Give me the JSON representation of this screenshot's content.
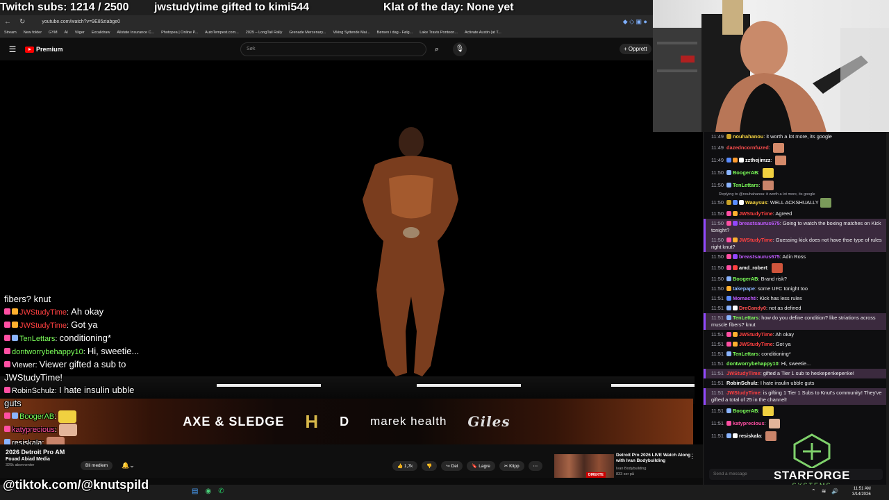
{
  "overlay": {
    "subs_goal": "Twitch subs: 1214 / 2500",
    "gift_alert": "jwstudytime gifted to kimi544",
    "klat": "Klat of the day: None yet",
    "tiktok": "@tiktok.com/@knutspild"
  },
  "browser": {
    "url": "youtube.com/watch?v=9E85ziabge0",
    "bookmarks": [
      "Stream",
      "New folder",
      "GYM",
      "AI",
      "Viiger",
      "Excalidraw",
      "Allstate Insurance C...",
      "Photopea | Online P...",
      "AutoTempest.com...",
      "2025 – LongTail Rally",
      "Grenade Mercenary...",
      "Viking Syttende Mai...",
      "Børsen i dag - Følg...",
      "Lake Travis Pontoon...",
      "Activate Austin (at T..."
    ]
  },
  "youtube": {
    "brand": "Premium",
    "search_placeholder": "Søk",
    "create_label": "Opprett",
    "channel_name": "Fouad Abiad Media",
    "channel_subs": "326k abonnenter",
    "member_label": "Bli medlem",
    "actions": [
      "1,7k",
      "",
      "Del",
      "Lagre",
      "Klipp",
      "⋯"
    ],
    "video_title_overlay": "2026 Detroit Pro AM",
    "sponsors": [
      "AXE & SLEDGE",
      "H",
      "D",
      "marek health",
      "Giles"
    ],
    "rec": {
      "title": "Detroit Pro 2026 LIVE Watch Along with Ivan Bodybuilding",
      "channel": "Ivan Bodybuilding",
      "views": "833 ser på",
      "live_badge": "DIREKTE"
    }
  },
  "chat": {
    "input_placeholder": "Send a message",
    "messages": [
      {
        "ts": "11:49",
        "user": "nouhahanou",
        "color": "#f5d342",
        "text": "it worth a lot more, its google",
        "badges": [
          "#c9a227"
        ],
        "emote": null,
        "hl": false
      },
      {
        "ts": "11:49",
        "user": "dazedncornfuzed",
        "color": "#ff4e4e",
        "text": "",
        "badges": [],
        "emote": "#d58a6a",
        "hl": false
      },
      {
        "ts": "11:49",
        "user": "zzthejimzz",
        "color": "#ffffff",
        "text": "",
        "badges": [
          "#5a8cff",
          "#ff9b2f",
          "#ffffff"
        ],
        "emote": "#d58a6a",
        "hl": false
      },
      {
        "ts": "11:50",
        "user": "BoogerAB",
        "color": "#7cff5a",
        "text": "",
        "badges": [
          "#8ab4ff"
        ],
        "emote": "#f0d040",
        "hl": false
      },
      {
        "ts": "11:50",
        "user": "TenLettars",
        "color": "#7cff5a",
        "text": "",
        "badges": [
          "#8ab4ff"
        ],
        "emote": "#c9846a",
        "hl": false
      },
      {
        "ts": "11:50",
        "user": "Waaysus",
        "color": "#f5d342",
        "text": "WELL ACKSHUALLY",
        "badges": [
          "#c9a227",
          "#5a8cff",
          "#ffffff"
        ],
        "emote": "#7a9a5a",
        "hl": false,
        "reply": "Replying to @nouhahanou: it worth a lot more, its google"
      },
      {
        "ts": "11:50",
        "user": "JWStudyTime",
        "color": "#ff4040",
        "text": "Agreed",
        "badges": [
          "#ff4fa3",
          "#ffb02e"
        ],
        "emote": null,
        "hl": false
      },
      {
        "ts": "11:50",
        "user": "breastsaurus675",
        "color": "#c05bff",
        "text": "Going to watch the boxing matches on Kick tonight?",
        "badges": [
          "#ff4fa3",
          "#9147ff"
        ],
        "emote": null,
        "hl": true
      },
      {
        "ts": "11:50",
        "user": "JWStudyTime",
        "color": "#ff4040",
        "text": "Guessing kick does not have thse type of rules right knut?",
        "badges": [
          "#ff4fa3",
          "#ffb02e"
        ],
        "emote": null,
        "hl": true
      },
      {
        "ts": "11:50",
        "user": "breastsaurus675",
        "color": "#c05bff",
        "text": "Adin Ross",
        "badges": [
          "#ff4fa3",
          "#9147ff"
        ],
        "emote": null,
        "hl": false
      },
      {
        "ts": "11:50",
        "user": "amd_robert",
        "color": "#ffffff",
        "text": "",
        "badges": [
          "#ff4fa3",
          "#ff4040"
        ],
        "emote": "#d0553c",
        "hl": false
      },
      {
        "ts": "11:50",
        "user": "BoogerAB",
        "color": "#7cff5a",
        "text": "Brand risk?",
        "badges": [
          "#8ab4ff"
        ],
        "emote": null,
        "hl": false
      },
      {
        "ts": "11:50",
        "user": "takepape",
        "color": "#8ab4ff",
        "text": "some UFC tonight too",
        "badges": [
          "#ffb02e"
        ],
        "emote": null,
        "hl": false
      },
      {
        "ts": "11:51",
        "user": "Momachti",
        "color": "#c05bff",
        "text": "Kick has less rules",
        "badges": [
          "#5a8cff"
        ],
        "emote": null,
        "hl": false
      },
      {
        "ts": "11:51",
        "user": "DreCandy0",
        "color": "#ff4e4e",
        "text": "not as defined",
        "badges": [
          "#8ab4ff",
          "#ffffff"
        ],
        "emote": null,
        "hl": false
      },
      {
        "ts": "11:51",
        "user": "TenLettars",
        "color": "#7cff5a",
        "text": "how do you define condition? like striations across muscle fibers? knut",
        "badges": [
          "#8ab4ff"
        ],
        "emote": null,
        "hl": true
      },
      {
        "ts": "11:51",
        "user": "JWStudyTime",
        "color": "#ff4040",
        "text": "Ah okay",
        "badges": [
          "#ff4fa3",
          "#ffb02e"
        ],
        "emote": null,
        "hl": false
      },
      {
        "ts": "11:51",
        "user": "JWStudyTime",
        "color": "#ff4040",
        "text": "Got ya",
        "badges": [
          "#ff4fa3",
          "#ffb02e"
        ],
        "emote": null,
        "hl": false
      },
      {
        "ts": "11:51",
        "user": "TenLettars",
        "color": "#7cff5a",
        "text": "conditioning*",
        "badges": [
          "#8ab4ff"
        ],
        "emote": null,
        "hl": false
      },
      {
        "ts": "11:51",
        "user": "dontworrybehappy10",
        "color": "#7cff5a",
        "text": "Hi, sweetie...",
        "badges": [],
        "emote": null,
        "hl": false
      },
      {
        "ts": "11:51",
        "user": "JWStudyTime",
        "color": "#ff4040",
        "text": "gifted a Tier 1 sub to heskepenkepenke!",
        "badges": [],
        "emote": null,
        "hl": true
      },
      {
        "ts": "11:51",
        "user": "RobinSchulz",
        "color": "#ffffff",
        "text": "I hate insulin ubble guts",
        "badges": [],
        "emote": null,
        "hl": false
      },
      {
        "ts": "11:51",
        "user": "JWStudyTime",
        "color": "#ff4040",
        "text": "is gifting 1 Tier 1 Subs to Knut's community! They've gifted a total of 25 in the channel!",
        "badges": [],
        "emote": null,
        "hl": true
      },
      {
        "ts": "11:51",
        "user": "BoogerAB",
        "color": "#7cff5a",
        "text": "",
        "badges": [
          "#8ab4ff"
        ],
        "emote": "#f0d040",
        "hl": false
      },
      {
        "ts": "11:51",
        "user": "katyprecious",
        "color": "#ff4fa3",
        "text": "",
        "badges": [
          "#ff4fa3"
        ],
        "emote": "#e3b59a",
        "hl": false
      },
      {
        "ts": "11:51",
        "user": "resiskala",
        "color": "#ffffff",
        "text": "",
        "badges": [
          "#8ab4ff",
          "#ffffff"
        ],
        "emote": "#c9846a",
        "hl": false
      }
    ]
  },
  "overlay_chat": [
    {
      "user": "",
      "text": "fibers? knut",
      "color": "#ffffff",
      "badges": []
    },
    {
      "user": "JWStudyTime",
      "text": "Ah okay",
      "color": "#ff4040",
      "badges": [
        "#ff4fa3",
        "#ffb02e"
      ]
    },
    {
      "user": "JWStudyTime",
      "text": "Got ya",
      "color": "#ff4040",
      "badges": [
        "#ff4fa3",
        "#ffb02e"
      ]
    },
    {
      "user": "TenLettars",
      "text": "conditioning*",
      "color": "#7cff5a",
      "badges": [
        "#ff4fa3",
        "#8ab4ff"
      ]
    },
    {
      "user": "dontworrybehappy10",
      "text": "Hi, sweetie...",
      "color": "#7cff5a",
      "badges": [
        "#ff4fa3"
      ]
    },
    {
      "user": "Viewer",
      "text": "Viewer gifted a sub to JWStudyTime!",
      "color": "#ffffff",
      "badges": [
        "#ff4fa3"
      ]
    },
    {
      "user": "RobinSchulz",
      "text": "I hate insulin ubble guts",
      "color": "#ffffff",
      "badges": [
        "#ff4fa3"
      ]
    },
    {
      "user": "BoogerAB",
      "text": "",
      "color": "#7cff5a",
      "badges": [
        "#ff4fa3",
        "#8ab4ff"
      ],
      "emote": "#f0d040"
    },
    {
      "user": "katyprecious",
      "text": "",
      "color": "#ff4fa3",
      "badges": [
        "#ff4fa3"
      ],
      "emote": "#e3b59a"
    },
    {
      "user": "resiskala",
      "text": "",
      "color": "#ffffff",
      "badges": [
        "#8ab4ff"
      ],
      "emote": "#c9846a"
    }
  ],
  "branding": {
    "name": "STARFORGE",
    "sub": "SYSTEMS"
  },
  "clock": {
    "time": "11:51 AM",
    "date": "3/14/2026"
  }
}
